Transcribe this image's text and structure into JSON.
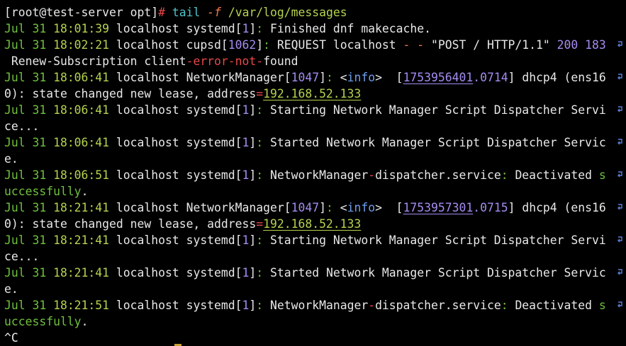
{
  "terminal": {
    "colors": {
      "default": "#e8e8e8",
      "green": "#6fc13e",
      "lime": "#b5d34f",
      "purple": "#a58cf0",
      "red": "#e64848",
      "orange": "#f07a4a",
      "cyan": "#4ec3c7",
      "blue": "#6e9ff0",
      "wrap": "#5a7fd8"
    },
    "lines": [
      {
        "wrap": false,
        "segs": [
          {
            "t": "[root@test-server opt]",
            "c": "default"
          },
          {
            "t": "# ",
            "c": "red"
          },
          {
            "t": "tail",
            "c": "cyan"
          },
          {
            "t": " ",
            "c": "default"
          },
          {
            "t": "-f",
            "c": "orange",
            "i": true
          },
          {
            "t": " /var/log/messages",
            "c": "lime"
          }
        ]
      },
      {
        "wrap": false,
        "segs": [
          {
            "t": "Jul 31 ",
            "c": "green"
          },
          {
            "t": "18:01:39",
            "c": "lime"
          },
          {
            "t": " localhost systemd[",
            "c": "default"
          },
          {
            "t": "1",
            "c": "purple"
          },
          {
            "t": "]",
            "c": "default"
          },
          {
            "t": ": ",
            "c": "green"
          },
          {
            "t": "Finished dnf makecache.",
            "c": "default"
          }
        ]
      },
      {
        "wrap": true,
        "segs": [
          {
            "t": "Jul 31 ",
            "c": "green"
          },
          {
            "t": "18:02:21",
            "c": "lime"
          },
          {
            "t": " localhost cupsd[",
            "c": "default"
          },
          {
            "t": "1062",
            "c": "purple"
          },
          {
            "t": "]",
            "c": "default"
          },
          {
            "t": ": ",
            "c": "green"
          },
          {
            "t": "REQUEST localhost ",
            "c": "default"
          },
          {
            "t": "- -",
            "c": "orange"
          },
          {
            "t": " \"POST / HTTP/1.1\" ",
            "c": "default"
          },
          {
            "t": "200 183",
            "c": "purple"
          }
        ]
      },
      {
        "wrap": false,
        "segs": [
          {
            "t": " Renew-Subscription client",
            "c": "default"
          },
          {
            "t": "-error-not-",
            "c": "red"
          },
          {
            "t": "found",
            "c": "default"
          }
        ]
      },
      {
        "wrap": true,
        "segs": [
          {
            "t": "Jul 31 ",
            "c": "green"
          },
          {
            "t": "18:06:41",
            "c": "lime"
          },
          {
            "t": " localhost NetworkManager[",
            "c": "default"
          },
          {
            "t": "1047",
            "c": "purple"
          },
          {
            "t": "]",
            "c": "default"
          },
          {
            "t": ": ",
            "c": "green"
          },
          {
            "t": "<",
            "c": "default"
          },
          {
            "t": "info",
            "c": "blue"
          },
          {
            "t": ">  [",
            "c": "default"
          },
          {
            "t": "1753956401",
            "c": "purple",
            "u": true
          },
          {
            "t": ".0714",
            "c": "purple"
          },
          {
            "t": "] dhcp4 (ens16",
            "c": "default"
          }
        ]
      },
      {
        "wrap": false,
        "segs": [
          {
            "t": "0): state changed new lease, address",
            "c": "default"
          },
          {
            "t": "=",
            "c": "red"
          },
          {
            "t": "192.168.52.133",
            "c": "lime",
            "u": true
          }
        ]
      },
      {
        "wrap": true,
        "segs": [
          {
            "t": "Jul 31 ",
            "c": "green"
          },
          {
            "t": "18:06:41",
            "c": "lime"
          },
          {
            "t": " localhost systemd[",
            "c": "default"
          },
          {
            "t": "1",
            "c": "purple"
          },
          {
            "t": "]",
            "c": "default"
          },
          {
            "t": ": ",
            "c": "green"
          },
          {
            "t": "Starting Network Manager Script Dispatcher Servi",
            "c": "default"
          }
        ]
      },
      {
        "wrap": false,
        "segs": [
          {
            "t": "ce...",
            "c": "default"
          }
        ]
      },
      {
        "wrap": true,
        "segs": [
          {
            "t": "Jul 31 ",
            "c": "green"
          },
          {
            "t": "18:06:41",
            "c": "lime"
          },
          {
            "t": " localhost systemd[",
            "c": "default"
          },
          {
            "t": "1",
            "c": "purple"
          },
          {
            "t": "]",
            "c": "default"
          },
          {
            "t": ": ",
            "c": "green"
          },
          {
            "t": "Started Network Manager Script Dispatcher Servic",
            "c": "default"
          }
        ]
      },
      {
        "wrap": false,
        "segs": [
          {
            "t": "e.",
            "c": "default"
          }
        ]
      },
      {
        "wrap": true,
        "segs": [
          {
            "t": "Jul 31 ",
            "c": "green"
          },
          {
            "t": "18:06:51",
            "c": "lime"
          },
          {
            "t": " localhost systemd[",
            "c": "default"
          },
          {
            "t": "1",
            "c": "purple"
          },
          {
            "t": "]",
            "c": "default"
          },
          {
            "t": ": ",
            "c": "green"
          },
          {
            "t": "NetworkManager",
            "c": "default"
          },
          {
            "t": "-",
            "c": "red"
          },
          {
            "t": "dispatcher.service",
            "c": "default"
          },
          {
            "t": ": ",
            "c": "green"
          },
          {
            "t": "Deactivated ",
            "c": "default"
          },
          {
            "t": "s",
            "c": "green"
          }
        ]
      },
      {
        "wrap": false,
        "segs": [
          {
            "t": "uccessfully",
            "c": "green"
          },
          {
            "t": ".",
            "c": "default"
          }
        ]
      },
      {
        "wrap": true,
        "segs": [
          {
            "t": "Jul 31 ",
            "c": "green"
          },
          {
            "t": "18:21:41",
            "c": "lime"
          },
          {
            "t": " localhost NetworkManager[",
            "c": "default"
          },
          {
            "t": "1047",
            "c": "purple"
          },
          {
            "t": "]",
            "c": "default"
          },
          {
            "t": ": ",
            "c": "green"
          },
          {
            "t": "<",
            "c": "default"
          },
          {
            "t": "info",
            "c": "blue"
          },
          {
            "t": ">  [",
            "c": "default"
          },
          {
            "t": "1753957301",
            "c": "purple",
            "u": true
          },
          {
            "t": ".0715",
            "c": "purple"
          },
          {
            "t": "] dhcp4 (ens16",
            "c": "default"
          }
        ]
      },
      {
        "wrap": false,
        "segs": [
          {
            "t": "0): state changed new lease, address",
            "c": "default"
          },
          {
            "t": "=",
            "c": "red"
          },
          {
            "t": "192.168.52.133",
            "c": "lime",
            "u": true
          }
        ]
      },
      {
        "wrap": true,
        "segs": [
          {
            "t": "Jul 31 ",
            "c": "green"
          },
          {
            "t": "18:21:41",
            "c": "lime"
          },
          {
            "t": " localhost systemd[",
            "c": "default"
          },
          {
            "t": "1",
            "c": "purple"
          },
          {
            "t": "]",
            "c": "default"
          },
          {
            "t": ": ",
            "c": "green"
          },
          {
            "t": "Starting Network Manager Script Dispatcher Servi",
            "c": "default"
          }
        ]
      },
      {
        "wrap": false,
        "segs": [
          {
            "t": "ce...",
            "c": "default"
          }
        ]
      },
      {
        "wrap": true,
        "segs": [
          {
            "t": "Jul 31 ",
            "c": "green"
          },
          {
            "t": "18:21:41",
            "c": "lime"
          },
          {
            "t": " localhost systemd[",
            "c": "default"
          },
          {
            "t": "1",
            "c": "purple"
          },
          {
            "t": "]",
            "c": "default"
          },
          {
            "t": ": ",
            "c": "green"
          },
          {
            "t": "Started Network Manager Script Dispatcher Servic",
            "c": "default"
          }
        ]
      },
      {
        "wrap": false,
        "segs": [
          {
            "t": "e.",
            "c": "default"
          }
        ]
      },
      {
        "wrap": true,
        "segs": [
          {
            "t": "Jul 31 ",
            "c": "green"
          },
          {
            "t": "18:21:51",
            "c": "lime"
          },
          {
            "t": " localhost systemd[",
            "c": "default"
          },
          {
            "t": "1",
            "c": "purple"
          },
          {
            "t": "]",
            "c": "default"
          },
          {
            "t": ": ",
            "c": "green"
          },
          {
            "t": "NetworkManager",
            "c": "default"
          },
          {
            "t": "-",
            "c": "red"
          },
          {
            "t": "dispatcher.service",
            "c": "default"
          },
          {
            "t": ": ",
            "c": "green"
          },
          {
            "t": "Deactivated ",
            "c": "default"
          },
          {
            "t": "s",
            "c": "green"
          }
        ]
      },
      {
        "wrap": false,
        "segs": [
          {
            "t": "uccessfully",
            "c": "green"
          },
          {
            "t": ".",
            "c": "default"
          }
        ]
      },
      {
        "wrap": false,
        "segs": [
          {
            "t": "^C",
            "c": "default"
          }
        ]
      }
    ]
  }
}
